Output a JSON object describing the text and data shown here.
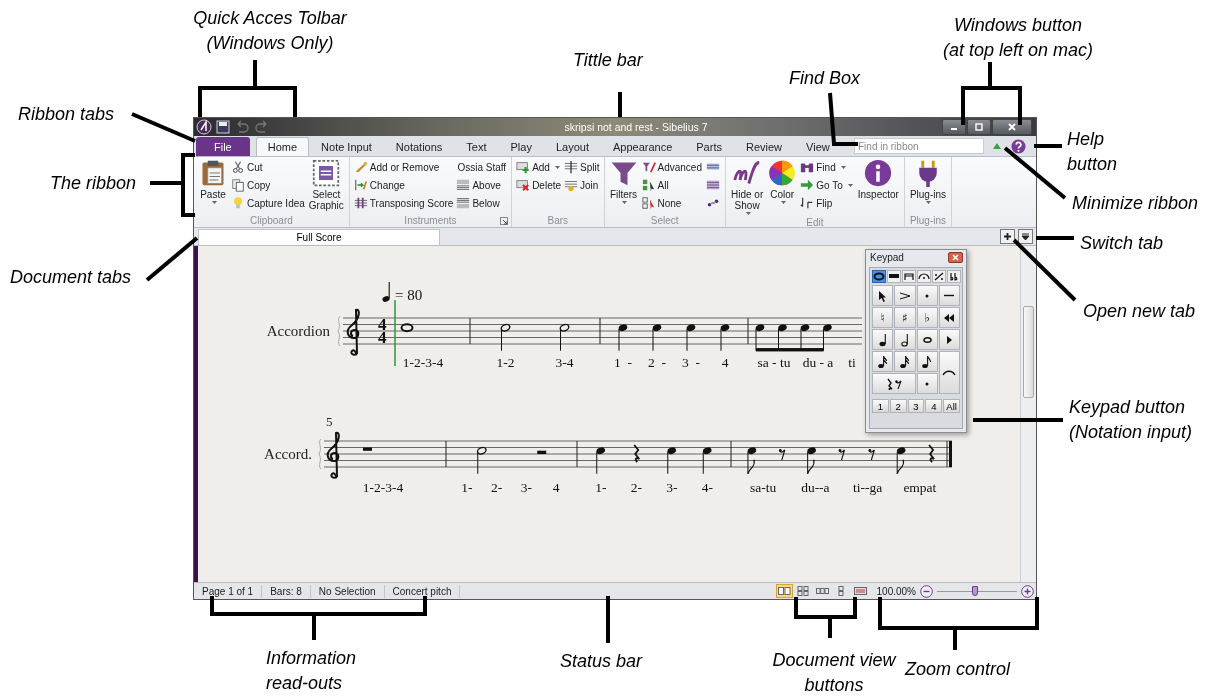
{
  "window": {
    "title": "skripsi not and rest - Sibelius 7"
  },
  "ribbon_tabs": [
    {
      "label": "File",
      "kind": "file",
      "selected": false
    },
    {
      "label": "Home",
      "kind": "tab",
      "selected": true
    },
    {
      "label": "Note Input",
      "kind": "tab",
      "selected": false
    },
    {
      "label": "Notations",
      "kind": "tab",
      "selected": false
    },
    {
      "label": "Text",
      "kind": "tab",
      "selected": false
    },
    {
      "label": "Play",
      "kind": "tab",
      "selected": false
    },
    {
      "label": "Layout",
      "kind": "tab",
      "selected": false
    },
    {
      "label": "Appearance",
      "kind": "tab",
      "selected": false
    },
    {
      "label": "Parts",
      "kind": "tab",
      "selected": false
    },
    {
      "label": "Review",
      "kind": "tab",
      "selected": false
    },
    {
      "label": "View",
      "kind": "tab",
      "selected": false
    }
  ],
  "find_box": {
    "placeholder": "Find in ribbon"
  },
  "ribbon": {
    "groups": [
      {
        "label": "Clipboard",
        "launcher": false,
        "columns": [
          [
            {
              "kind": "large",
              "lines": [
                "Paste"
              ],
              "dropdown": true
            }
          ],
          [
            {
              "kind": "small",
              "label": "Cut",
              "dropdown": false
            },
            {
              "kind": "small",
              "label": "Copy",
              "dropdown": false
            },
            {
              "kind": "small",
              "label": "Capture Idea",
              "dropdown": false
            }
          ],
          [
            {
              "kind": "large",
              "lines": [
                "Select",
                "Graphic"
              ],
              "dropdown": false
            }
          ]
        ]
      },
      {
        "label": "Instruments",
        "launcher": true,
        "columns": [
          [
            {
              "kind": "small",
              "label": "Add or Remove",
              "dropdown": false
            },
            {
              "kind": "small",
              "label": "Change",
              "dropdown": false
            },
            {
              "kind": "small",
              "label": "Transposing Score",
              "dropdown": false
            }
          ],
          [
            {
              "kind": "heading",
              "label": "Ossia Staff"
            },
            {
              "kind": "small",
              "label": "Above",
              "dropdown": false
            },
            {
              "kind": "small",
              "label": "Below",
              "dropdown": false
            }
          ]
        ]
      },
      {
        "label": "Bars",
        "launcher": false,
        "columns": [
          [
            {
              "kind": "small",
              "label": "Add",
              "dropdown": true
            },
            {
              "kind": "small",
              "label": "Delete",
              "dropdown": false
            }
          ],
          [
            {
              "kind": "small",
              "label": "Split",
              "dropdown": false
            },
            {
              "kind": "small",
              "label": "Join",
              "dropdown": false
            }
          ]
        ]
      },
      {
        "label": "Select",
        "launcher": false,
        "columns": [
          [
            {
              "kind": "large",
              "lines": [
                "Filters"
              ],
              "dropdown": true
            }
          ],
          [
            {
              "kind": "small",
              "label": "Advanced",
              "dropdown": false
            },
            {
              "kind": "small",
              "label": "All",
              "dropdown": false
            },
            {
              "kind": "small",
              "label": "None",
              "dropdown": false
            }
          ],
          [
            {
              "kind": "icon"
            },
            {
              "kind": "icon"
            },
            {
              "kind": "icon"
            }
          ]
        ]
      },
      {
        "label": "Edit",
        "launcher": false,
        "columns": [
          [
            {
              "kind": "large",
              "lines": [
                "Hide or",
                "Show"
              ],
              "dropdown": true
            }
          ],
          [
            {
              "kind": "large",
              "lines": [
                "Color"
              ],
              "dropdown": true
            }
          ],
          [
            {
              "kind": "small",
              "label": "Find",
              "dropdown": true
            },
            {
              "kind": "small",
              "label": "Go To",
              "dropdown": true
            },
            {
              "kind": "small",
              "label": "Flip",
              "dropdown": false
            }
          ],
          [
            {
              "kind": "large",
              "lines": [
                "Inspector"
              ],
              "dropdown": false
            }
          ]
        ]
      },
      {
        "label": "Plug-ins",
        "launcher": false,
        "columns": [
          [
            {
              "kind": "large",
              "lines": [
                "Plug-ins"
              ],
              "dropdown": true
            }
          ]
        ]
      }
    ]
  },
  "document_tabs": [
    {
      "label": "Full Score",
      "selected": true
    }
  ],
  "score": {
    "tempo": "= 80",
    "systems": [
      {
        "name": "Accordion",
        "time_signature": [
          "4",
          "4"
        ],
        "cursor": true,
        "final_barline": false,
        "bars": [
          {
            "notes": [
              {
                "kind": "whole"
              }
            ],
            "lyrics": [
              "1-2-3-4"
            ]
          },
          {
            "notes": [
              {
                "kind": "half"
              },
              {
                "kind": "half"
              }
            ],
            "lyrics": [
              "1-2",
              "3-4"
            ]
          },
          {
            "notes": [
              {
                "kind": "quarter"
              },
              {
                "kind": "quarter"
              },
              {
                "kind": "quarter"
              },
              {
                "kind": "quarter"
              }
            ],
            "lyrics": [
              "1  -",
              "2  -",
              "3  -",
              "4"
            ]
          },
          {
            "notes": [
              {
                "kind": "beamed"
              },
              {
                "kind": "beamed"
              },
              {
                "kind": "beamed"
              },
              {
                "kind": "beamed"
              }
            ],
            "lyrics": [
              "sa - tu",
              "du - a",
              "ti"
            ]
          }
        ]
      },
      {
        "name": "Accord.",
        "bar_number": "5",
        "cursor": false,
        "final_barline": true,
        "bars": [
          {
            "notes": [
              {
                "kind": "rest_whole"
              }
            ],
            "lyrics": [
              "1-2-3-4"
            ]
          },
          {
            "notes": [
              {
                "kind": "half"
              },
              {
                "kind": "rest_half"
              }
            ],
            "lyrics": [
              "1-",
              "2-",
              "3-",
              "4"
            ]
          },
          {
            "notes": [
              {
                "kind": "quarter"
              },
              {
                "kind": "rest_quarter"
              },
              {
                "kind": "quarter"
              },
              {
                "kind": "quarter"
              }
            ],
            "lyrics": [
              "1-",
              "2-",
              "3-",
              "4-"
            ]
          },
          {
            "notes": [
              {
                "kind": "eighth"
              },
              {
                "kind": "rest_eighth"
              },
              {
                "kind": "eighth"
              },
              {
                "kind": "rest_eighth"
              },
              {
                "kind": "rest_eighth"
              },
              {
                "kind": "eighth"
              },
              {
                "kind": "rest_quarter"
              }
            ],
            "lyrics": [
              "sa-tu",
              "du--a",
              "ti--ga",
              "empat"
            ]
          }
        ]
      }
    ]
  },
  "keypad": {
    "title": "Keypad",
    "tabs": [
      {
        "selected": true
      },
      {
        "selected": false
      },
      {
        "selected": false
      },
      {
        "selected": false
      },
      {
        "selected": false
      },
      {
        "selected": false
      }
    ],
    "accidentals": [
      "♮",
      "♯",
      "♭"
    ],
    "layouts": [
      "1",
      "2",
      "3",
      "4",
      "All"
    ]
  },
  "status_bar": {
    "readouts": [
      "Page 1 of 1",
      "Bars: 8",
      "No Selection",
      "Concert pitch"
    ],
    "view_buttons": [
      {
        "selected": true
      },
      {
        "selected": false
      },
      {
        "selected": false
      },
      {
        "selected": false
      },
      {
        "selected": false
      }
    ],
    "zoom": {
      "reading": "100.00%",
      "level": 0.47
    }
  },
  "annotations": [
    {
      "lines": [
        "Quick Acces Tolbar",
        "(Windows Only)"
      ]
    },
    {
      "lines": [
        "Tittle bar"
      ]
    },
    {
      "lines": [
        "Windows button",
        "(at top left on mac)"
      ]
    },
    {
      "lines": [
        "Find Box"
      ]
    },
    {
      "lines": [
        "Ribbon tabs"
      ]
    },
    {
      "lines": [
        "Help",
        "button"
      ]
    },
    {
      "lines": [
        "The ribbon"
      ]
    },
    {
      "lines": [
        "Minimize ribbon"
      ]
    },
    {
      "lines": [
        "Switch tab"
      ]
    },
    {
      "lines": [
        "Document tabs"
      ]
    },
    {
      "lines": [
        "Open new tab"
      ]
    },
    {
      "lines": [
        "Keypad button",
        "(Notation input)"
      ]
    },
    {
      "lines": [
        "Information",
        "read-outs"
      ]
    },
    {
      "lines": [
        "Status bar"
      ]
    },
    {
      "lines": [
        "Document view",
        "buttons"
      ]
    },
    {
      "lines": [
        "Zoom control"
      ]
    }
  ]
}
